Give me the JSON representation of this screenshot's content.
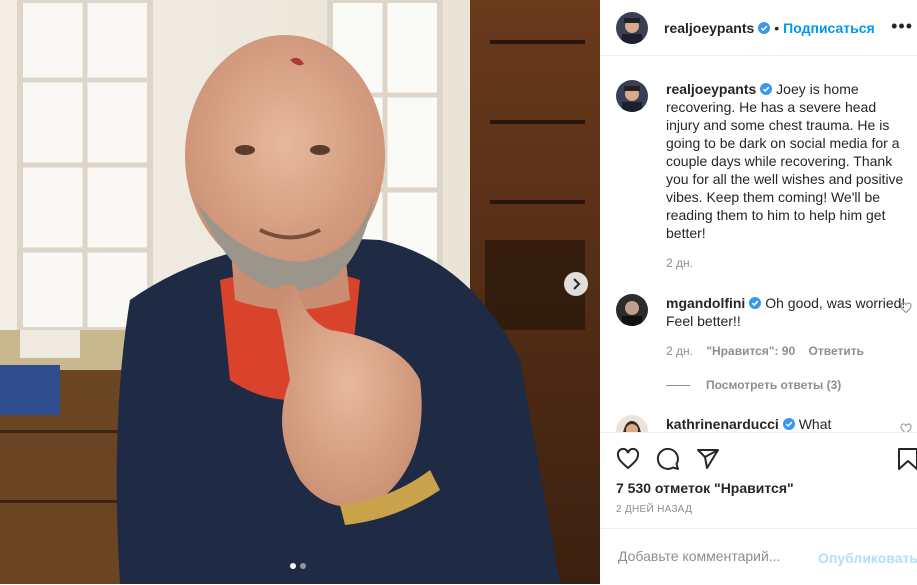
{
  "post": {
    "author": "realjoeypants",
    "verified": true,
    "separator": "•",
    "follow_label": "Подписаться",
    "more_label": "•••",
    "photo_count": 2,
    "photo_active_index": 1
  },
  "caption": {
    "username": "realjoeypants",
    "text": "Joey is home recovering. He has a severe head injury and some chest trauma. He is going to be dark on social media for a couple days while recovering. Thank you for all the well wishes and positive vibes. Keep them coming! We'll be reading them to him to help him get better!",
    "time": "2 дн."
  },
  "comments": [
    {
      "username": "mgandolfini",
      "verified": true,
      "text": "Oh good, was worried! Feel better!!",
      "time": "2 дн.",
      "likes": "\"Нравится\": 90",
      "reply_label": "Ответить",
      "view_replies": "Посмотреть ответы (3)"
    },
    {
      "username": "kathrinenarducci",
      "verified": true,
      "text": "What"
    }
  ],
  "stats": {
    "likes": "7 530 отметок \"Нравится\"",
    "posted_ago": "2 ДНЕЙ НАЗАД"
  },
  "add_comment": {
    "placeholder": "Добавьте комментарий...",
    "post_label": "Опубликовать"
  },
  "icons": {
    "like": "heart-icon",
    "comment": "comment-icon",
    "share": "share-icon",
    "save": "bookmark-icon",
    "next": "chevron-right-icon",
    "verified": "verified-badge-icon"
  },
  "colors": {
    "link": "#0095f6",
    "verified": "#3897f0",
    "muted": "#8e8e8e",
    "post_disabled": "#b2dffc"
  }
}
